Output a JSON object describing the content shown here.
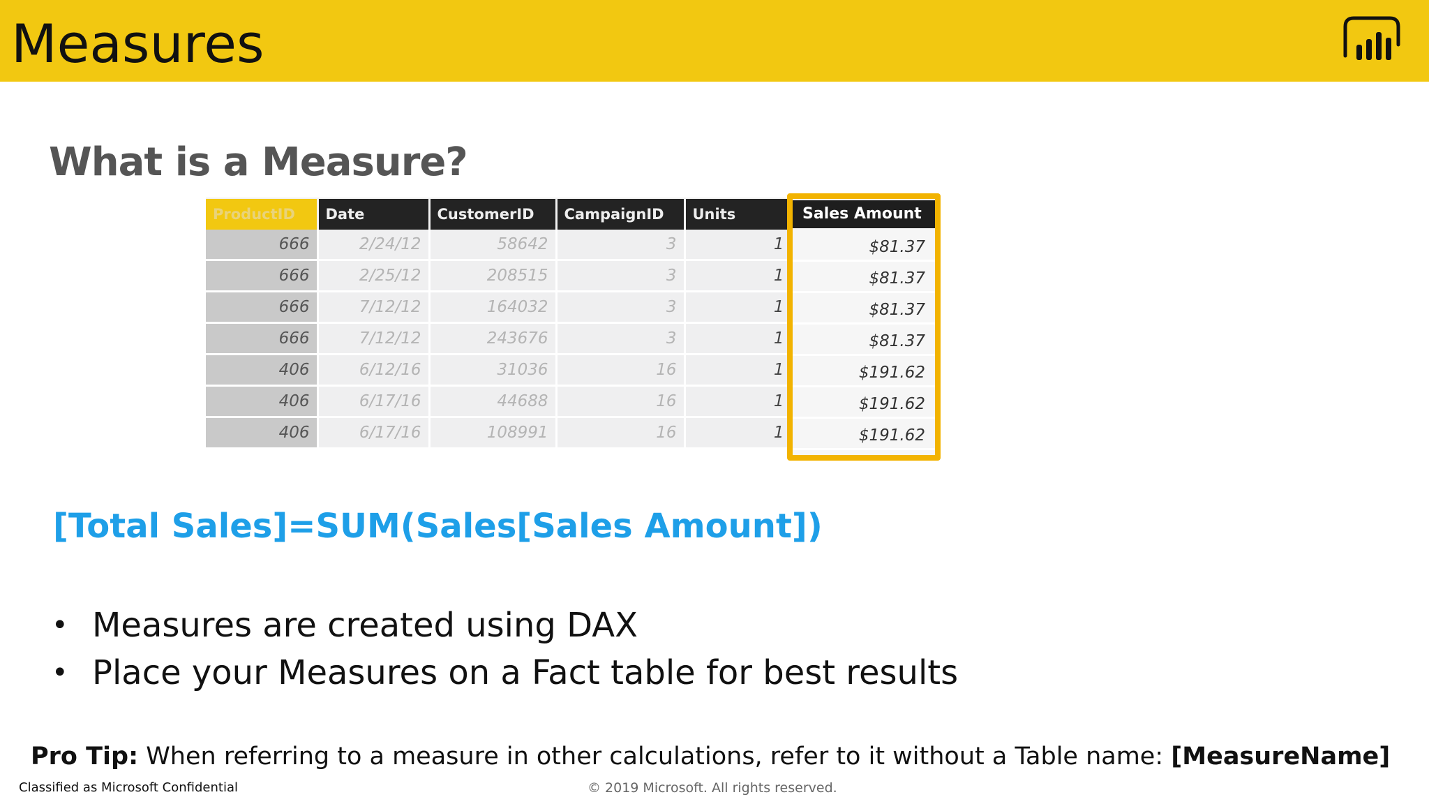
{
  "header": {
    "title": "Measures",
    "logo_icon": "power-bi-icon",
    "color": "#F2C811"
  },
  "subtitle": "What is a Measure?",
  "table": {
    "columns": [
      "ProductID",
      "Date",
      "CustomerID",
      "CampaignID",
      "Units",
      "Sales Amount"
    ],
    "rows": [
      [
        "666",
        "2/24/12",
        "58642",
        "3",
        "1",
        "$81.37"
      ],
      [
        "666",
        "2/25/12",
        "208515",
        "3",
        "1",
        "$81.37"
      ],
      [
        "666",
        "7/12/12",
        "164032",
        "3",
        "1",
        "$81.37"
      ],
      [
        "666",
        "7/12/12",
        "243676",
        "3",
        "1",
        "$81.37"
      ],
      [
        "406",
        "6/12/16",
        "31036",
        "16",
        "1",
        "$191.62"
      ],
      [
        "406",
        "6/17/16",
        "44688",
        "16",
        "1",
        "$191.62"
      ],
      [
        "406",
        "6/17/16",
        "108991",
        "16",
        "1",
        "$191.62"
      ]
    ]
  },
  "formula": "[Total Sales]=SUM(Sales[Sales Amount])",
  "bullets": [
    "Measures are created using DAX",
    "Place your Measures on a Fact table for best results"
  ],
  "protip": {
    "label": "Pro Tip:",
    "text": " When referring to a measure in other calculations, refer to it without a Table name: ",
    "emphasis": "[MeasureName]"
  },
  "footer": {
    "classification": "Classified as Microsoft Confidential",
    "copyright": "© 2019 Microsoft. All rights reserved."
  }
}
